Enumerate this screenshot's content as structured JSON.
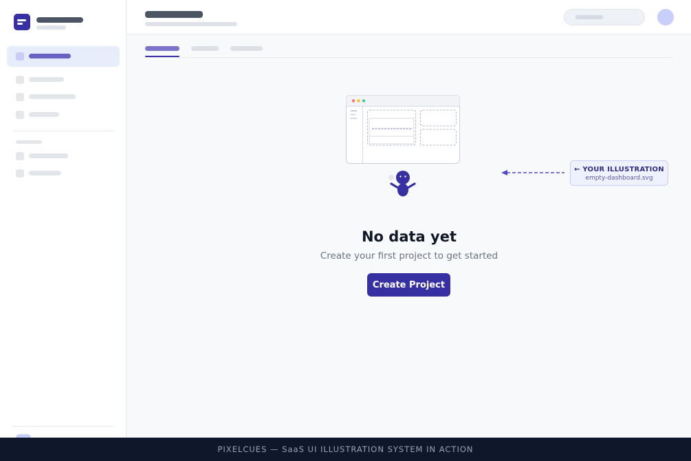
{
  "app": {
    "brand_color": "#3730a3",
    "accent_light": "#e8edfc"
  },
  "sidebar": {
    "logo_icon": "document-lines-icon",
    "nav_items_group1": [
      {
        "icon": "nav-square-icon",
        "state": "active"
      },
      {
        "icon": "nav-square-icon",
        "state": "inactive"
      },
      {
        "icon": "nav-square-icon",
        "state": "inactive"
      },
      {
        "icon": "nav-square-icon",
        "state": "inactive"
      }
    ],
    "nav_items_group2": [
      {
        "icon": "nav-square-icon",
        "state": "inactive"
      },
      {
        "icon": "nav-square-icon",
        "state": "inactive"
      }
    ]
  },
  "topbar": {
    "search_icon": "search-pill",
    "avatar_color": "#c7cffa"
  },
  "tabs": {
    "active_index": 0,
    "count": 3
  },
  "illustration": {
    "name": "empty-dashboard-illustration",
    "window_dots": [
      "#f87171",
      "#fbbf24",
      "#34d399"
    ]
  },
  "callout": {
    "title": "← YOUR ILLUSTRATION",
    "filename": "empty-dashboard.svg"
  },
  "empty_state": {
    "title": "No data yet",
    "subtitle": "Create your first project to get started",
    "cta_label": "Create Project"
  },
  "footer": {
    "text": "PIXELCUES — SaaS UI ILLUSTRATION SYSTEM IN ACTION"
  }
}
